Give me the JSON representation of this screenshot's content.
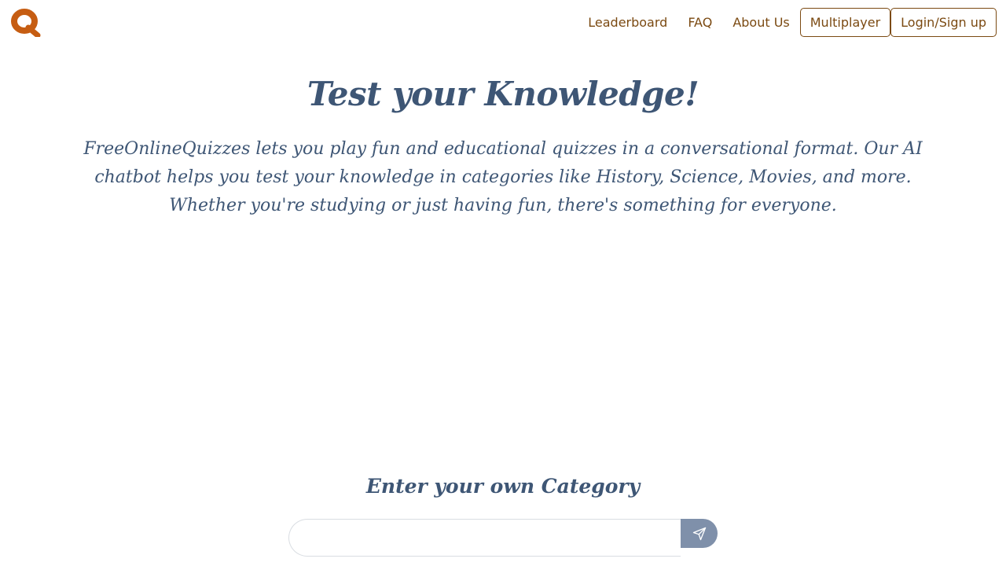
{
  "header": {
    "logo_letter": "Q",
    "nav": {
      "leaderboard": "Leaderboard",
      "faq": "FAQ",
      "about": "About Us",
      "multiplayer": "Multiplayer",
      "login": "Login/Sign up"
    }
  },
  "hero": {
    "title": "Test your Knowledge!",
    "description": "FreeOnlineQuizzes lets you play fun and educational quizzes in a conversational format. Our AI chatbot helps you test your knowledge in categories like History, Science, Movies, and more. Whether you're studying or just having fun, there's something for everyone."
  },
  "category": {
    "label": "Enter your own Category",
    "input_value": "",
    "input_placeholder": "",
    "send_icon": "paper-plane-icon"
  },
  "colors": {
    "brand_orange": "#c65d12",
    "nav_text": "#7b4a12",
    "heading_text": "#3e5675",
    "send_button_bg": "#7f90aa"
  }
}
